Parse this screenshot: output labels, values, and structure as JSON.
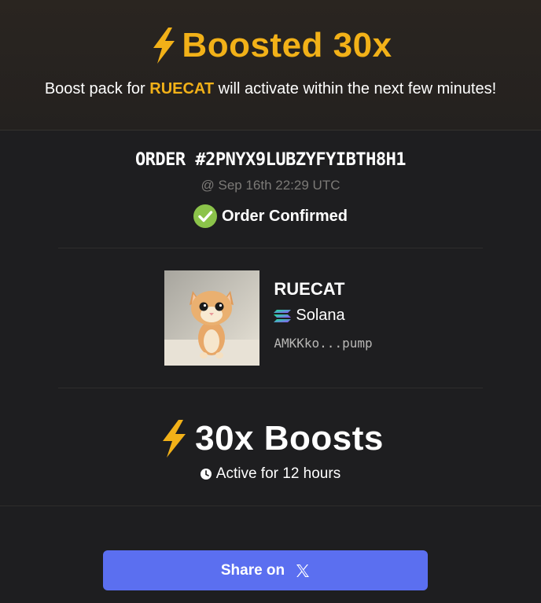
{
  "header": {
    "title": "Boosted 30x",
    "subtitle_pre": "Boost pack for ",
    "subtitle_token": "RUECAT",
    "subtitle_post": " will activate within the next few minutes!",
    "icon": "lightning-bolt-icon"
  },
  "order": {
    "id": "ORDER #2PNYX9LUBZYFYIBTH8H1",
    "date": "@ Sep 16th 22:29 UTC",
    "status": "Order Confirmed",
    "status_icon": "check-circle-icon"
  },
  "token": {
    "name": "RUECAT",
    "chain": "Solana",
    "chain_icon": "solana-icon",
    "address": "AMKKko...pump",
    "image": "kitten-photo"
  },
  "boost": {
    "label": "30x Boosts",
    "active_text": "Active for 12 hours",
    "icon": "lightning-bolt-icon",
    "clock_icon": "clock-icon"
  },
  "share": {
    "label": "Share on",
    "icon": "x-logo-icon"
  },
  "colors": {
    "accent": "#f2b118",
    "success": "#8bc34a",
    "button": "#5b6ff0",
    "background": "#1e1e20"
  }
}
